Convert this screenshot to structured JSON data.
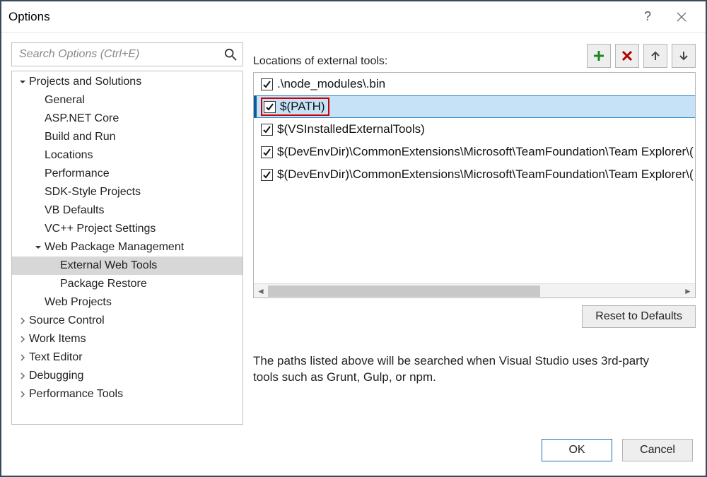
{
  "window": {
    "title": "Options"
  },
  "search": {
    "placeholder": "Search Options (Ctrl+E)"
  },
  "tree": [
    {
      "label": "Projects and Solutions",
      "level": 0,
      "state": "expanded"
    },
    {
      "label": "General",
      "level": 1,
      "state": "leaf"
    },
    {
      "label": "ASP.NET Core",
      "level": 1,
      "state": "leaf"
    },
    {
      "label": "Build and Run",
      "level": 1,
      "state": "leaf"
    },
    {
      "label": "Locations",
      "level": 1,
      "state": "leaf"
    },
    {
      "label": "Performance",
      "level": 1,
      "state": "leaf"
    },
    {
      "label": "SDK-Style Projects",
      "level": 1,
      "state": "leaf"
    },
    {
      "label": "VB Defaults",
      "level": 1,
      "state": "leaf"
    },
    {
      "label": "VC++ Project Settings",
      "level": 1,
      "state": "leaf"
    },
    {
      "label": "Web Package Management",
      "level": 1,
      "state": "expanded"
    },
    {
      "label": "External Web Tools",
      "level": 2,
      "state": "leaf",
      "selected": true
    },
    {
      "label": "Package Restore",
      "level": 2,
      "state": "leaf"
    },
    {
      "label": "Web Projects",
      "level": 1,
      "state": "leaf"
    },
    {
      "label": "Source Control",
      "level": 0,
      "state": "collapsed"
    },
    {
      "label": "Work Items",
      "level": 0,
      "state": "collapsed"
    },
    {
      "label": "Text Editor",
      "level": 0,
      "state": "collapsed"
    },
    {
      "label": "Debugging",
      "level": 0,
      "state": "collapsed"
    },
    {
      "label": "Performance Tools",
      "level": 0,
      "state": "collapsed"
    }
  ],
  "right": {
    "heading": "Locations of external tools:",
    "items": [
      {
        "text": ".\\node_modules\\.bin",
        "checked": true
      },
      {
        "text": "$(PATH)",
        "checked": true,
        "selected": true,
        "highlight": true
      },
      {
        "text": "$(VSInstalledExternalTools)",
        "checked": true
      },
      {
        "text": "$(DevEnvDir)\\CommonExtensions\\Microsoft\\TeamFoundation\\Team Explorer\\(",
        "checked": true
      },
      {
        "text": "$(DevEnvDir)\\CommonExtensions\\Microsoft\\TeamFoundation\\Team Explorer\\(",
        "checked": true
      }
    ],
    "reset_label": "Reset to Defaults",
    "description": "The paths listed above will be searched when Visual Studio uses 3rd-party tools such as Grunt, Gulp, or npm."
  },
  "footer": {
    "ok": "OK",
    "cancel": "Cancel"
  }
}
